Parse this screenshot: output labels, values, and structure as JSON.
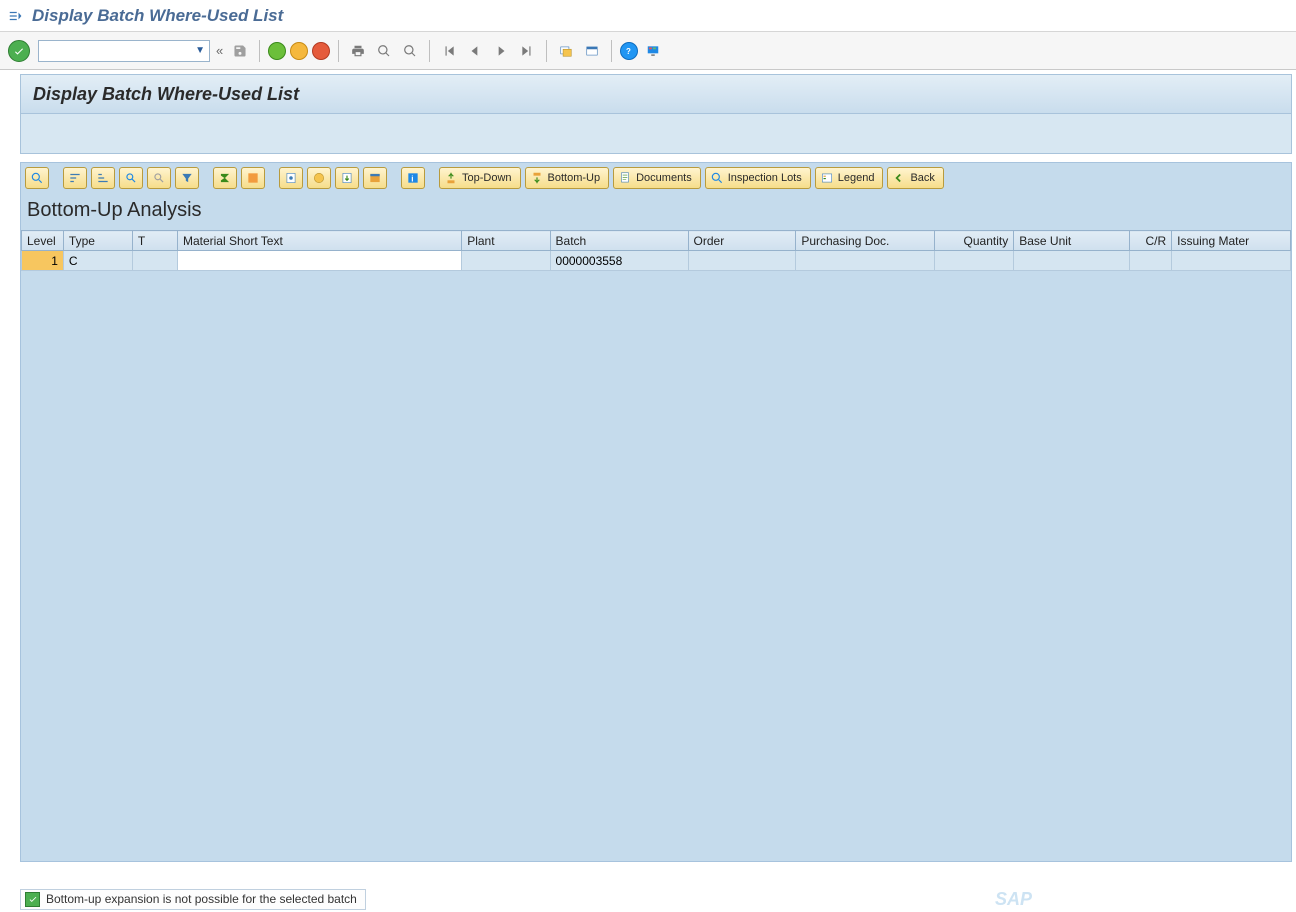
{
  "window": {
    "title": "Display Batch Where-Used List"
  },
  "page_header": {
    "title": "Display Batch Where-Used List"
  },
  "app_toolbar": {
    "top_down": "Top-Down",
    "bottom_up": "Bottom-Up",
    "documents": "Documents",
    "inspection_lots": "Inspection Lots",
    "legend": "Legend",
    "back": "Back"
  },
  "analysis": {
    "title": "Bottom-Up Analysis"
  },
  "table": {
    "headers": {
      "level": "Level",
      "type": "Type",
      "t": "T",
      "material_text": "Material Short Text",
      "plant": "Plant",
      "batch": "Batch",
      "order": "Order",
      "purchasing_doc": "Purchasing Doc.",
      "quantity": "Quantity",
      "base_unit": "Base Unit",
      "cr": "C/R",
      "issuing_mater": "Issuing Mater"
    },
    "rows": [
      {
        "level": "1",
        "type": "C",
        "t": "",
        "material_text": "",
        "plant": "",
        "batch": "0000003558",
        "order": "",
        "purchasing_doc": "",
        "quantity": "",
        "base_unit": "",
        "cr": "",
        "issuing_mater": ""
      }
    ]
  },
  "status": {
    "message": "Bottom-up expansion is not possible for the selected batch"
  },
  "branding": {
    "logo": "SAP"
  }
}
